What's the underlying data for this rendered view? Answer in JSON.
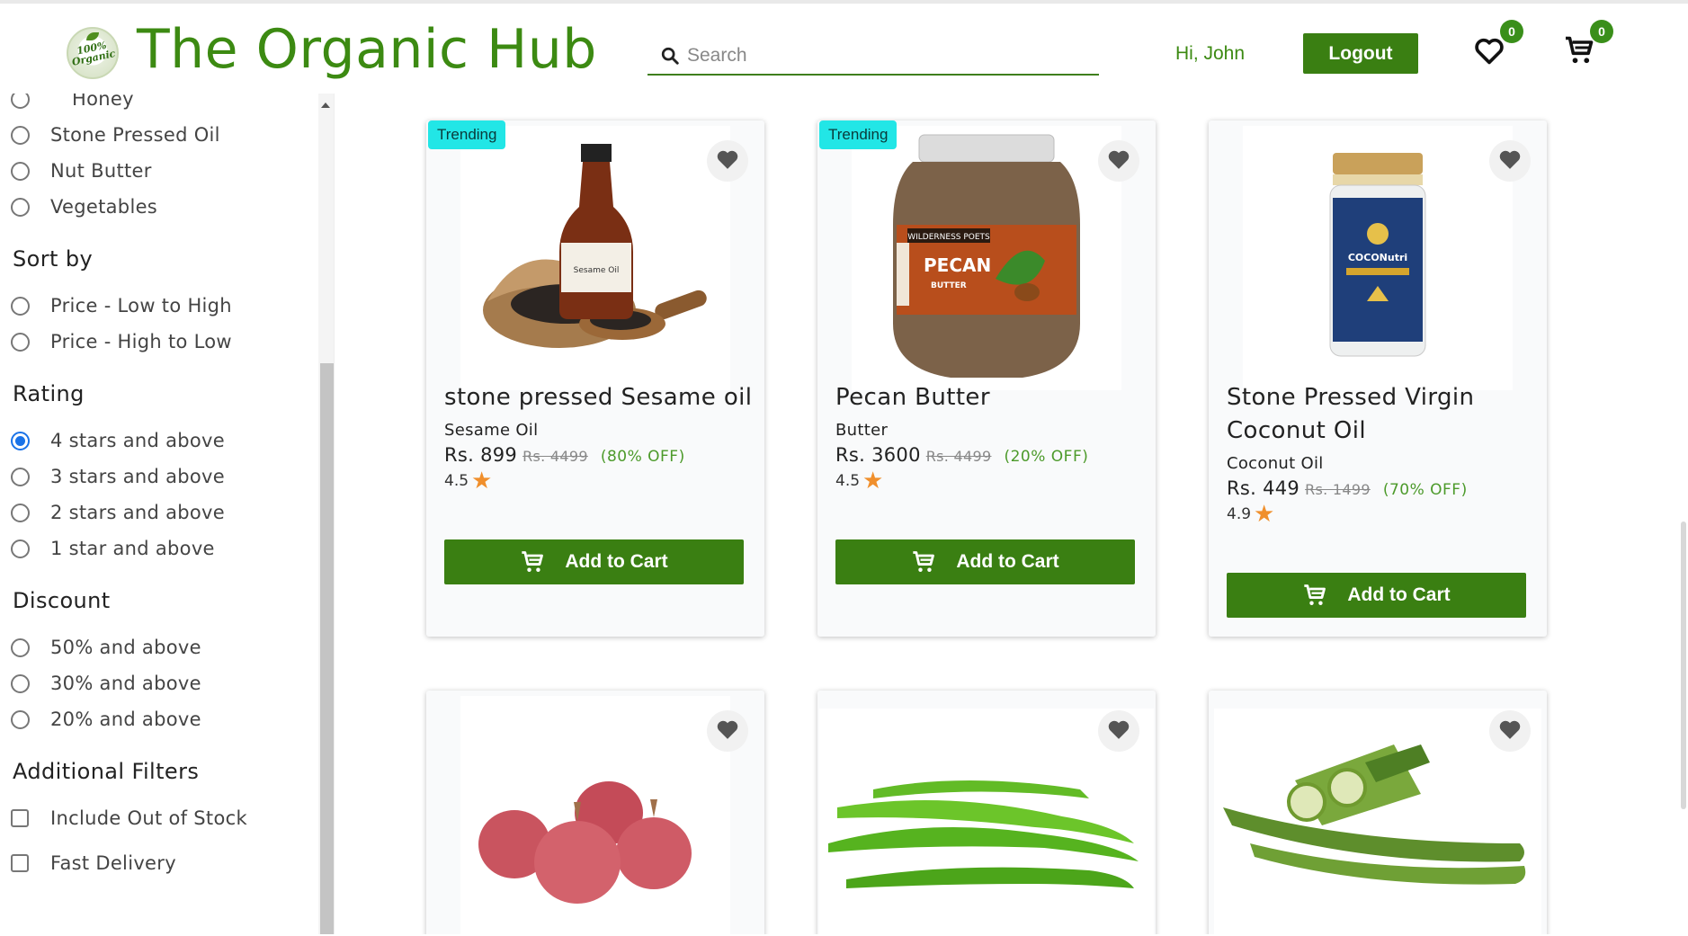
{
  "header": {
    "logo_badge_text": "100% Organic",
    "brand": "The Organic Hub",
    "search_placeholder": "Search",
    "greeting": "Hi, John",
    "logout_label": "Logout",
    "wishlist_count": "0",
    "cart_count": "0"
  },
  "sidebar": {
    "category_options": [
      "Honey",
      "Stone Pressed Oil",
      "Nut Butter",
      "Vegetables"
    ],
    "sort_title": "Sort by",
    "sort_options": [
      "Price - Low to High",
      "Price - High to Low"
    ],
    "rating_title": "Rating",
    "rating_options": [
      "4 stars and above",
      "3 stars and above",
      "2 stars and above",
      "1 star and above"
    ],
    "rating_selected": "4 stars and above",
    "discount_title": "Discount",
    "discount_options": [
      "50% and above",
      "30% and above",
      "20% and above"
    ],
    "additional_title": "Additional Filters",
    "additional_options": [
      "Include Out of Stock",
      "Fast Delivery"
    ]
  },
  "products": [
    {
      "badge": "Trending",
      "name": "stone pressed Sesame oil",
      "category": "Sesame Oil",
      "price": "Rs. 899",
      "mrp": "Rs. 4499",
      "discount": "(80% OFF)",
      "rating": "4.5",
      "cta": "Add to Cart",
      "image": "sesame-oil-bottle"
    },
    {
      "badge": "Trending",
      "name": "Pecan Butter",
      "category": "Butter",
      "price": "Rs. 3600",
      "mrp": "Rs. 4499",
      "discount": "(20% OFF)",
      "rating": "4.5",
      "cta": "Add to Cart",
      "image": "pecan-butter-jar",
      "jar_label_brand": "WILDERNESS POETS",
      "jar_label_title": "PECAN",
      "jar_label_sub": "BUTTER"
    },
    {
      "badge": "",
      "name_line1": "Stone Pressed Virgin",
      "name_line2": "Coconut Oil",
      "category": "Coconut Oil",
      "price": "Rs. 449",
      "mrp": "Rs. 1499",
      "discount": "(70% OFF)",
      "rating": "4.9",
      "cta": "Add to Cart",
      "image": "coconut-oil-jar",
      "jar_label_title": "COCONutri"
    },
    {
      "image": "onions"
    },
    {
      "image": "green-chillies"
    },
    {
      "image": "okra"
    }
  ],
  "colors": {
    "brand_green": "#3c8a12",
    "button_green": "#3a7f12",
    "trending_badge": "#22e6e6",
    "discount_text": "#4c9a2a",
    "star": "#f08f2c",
    "radio_selected": "#1a73e8"
  }
}
